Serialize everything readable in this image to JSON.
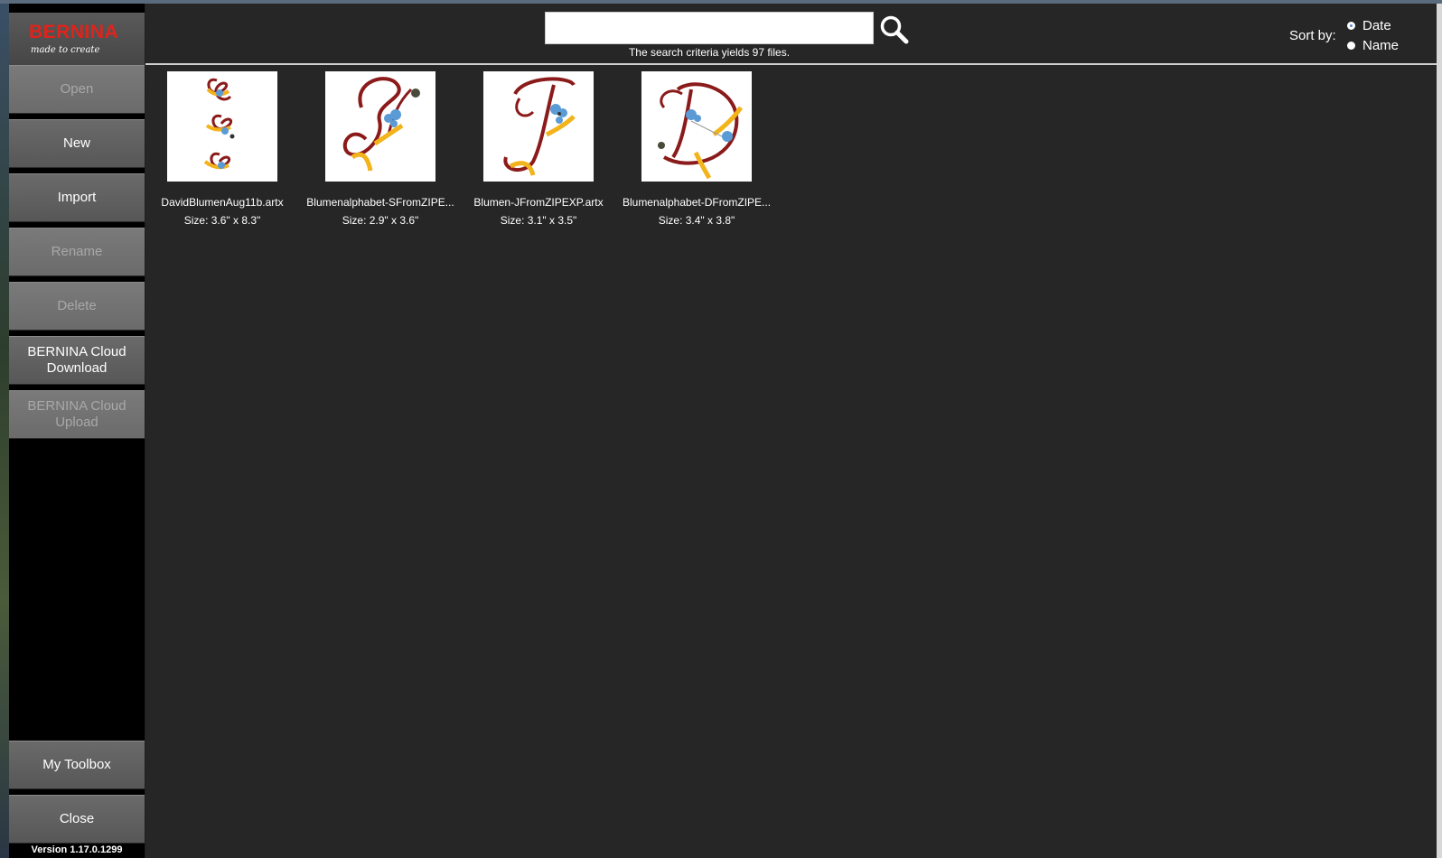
{
  "brand": {
    "name": "BERNINA",
    "tagline": "made to create",
    "accent_color": "#e0231b"
  },
  "sidebar": {
    "buttons": [
      {
        "id": "open",
        "label": "Open",
        "enabled": false
      },
      {
        "id": "new",
        "label": "New",
        "enabled": true
      },
      {
        "id": "import",
        "label": "Import",
        "enabled": true
      },
      {
        "id": "rename",
        "label": "Rename",
        "enabled": false
      },
      {
        "id": "delete",
        "label": "Delete",
        "enabled": false
      },
      {
        "id": "cloud-download",
        "label": "BERNINA Cloud Download",
        "enabled": true
      },
      {
        "id": "cloud-upload",
        "label": "BERNINA Cloud Upload",
        "enabled": false
      }
    ],
    "bottom_buttons": [
      {
        "id": "my-toolbox",
        "label": "My Toolbox",
        "enabled": true
      },
      {
        "id": "close",
        "label": "Close",
        "enabled": true
      }
    ],
    "version": "Version 1.17.0.1299"
  },
  "search": {
    "value": "",
    "placeholder": "",
    "icon": "magnifier-icon",
    "status": "The search criteria yields 97 files."
  },
  "sort": {
    "label": "Sort by:",
    "options": [
      {
        "label": "Date",
        "selected": true
      },
      {
        "label": "Name",
        "selected": false
      }
    ]
  },
  "files": [
    {
      "name": "DavidBlumenAug11b.artx",
      "size": "Size: 3.6\" x 8.3\"",
      "thumbnail": "letter-stack-design"
    },
    {
      "name": "Blumenalphabet-SFromZIPE...",
      "size": "Size: 2.9\" x 3.6\"",
      "thumbnail": "letter-s-design"
    },
    {
      "name": "Blumen-JFromZIPEXP.artx",
      "size": "Size: 3.1\" x 3.5\"",
      "thumbnail": "letter-j-design"
    },
    {
      "name": "Blumenalphabet-DFromZIPE...",
      "size": "Size: 3.4\" x 3.8\"",
      "thumbnail": "letter-d-design"
    }
  ]
}
